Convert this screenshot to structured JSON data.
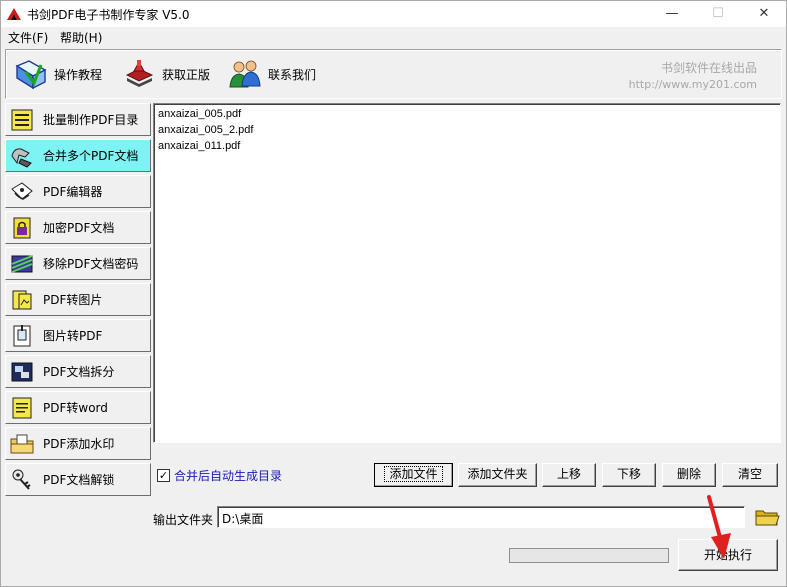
{
  "window": {
    "title": "书剑PDF电子书制作专家 V5.0",
    "minimize": "—",
    "maximize": "☐",
    "close": "✕"
  },
  "menu": [
    {
      "label": "文件(F)"
    },
    {
      "label": "帮助(H)"
    }
  ],
  "toolbar": {
    "tutorial": "操作教程",
    "buy": "获取正版",
    "contact": "联系我们",
    "brand_line1": "书剑软件在线出品",
    "brand_line2": "http://www.my201.com"
  },
  "sidebar": {
    "items": [
      {
        "label": "批量制作PDF目录",
        "icon": "toc-list-icon"
      },
      {
        "label": "合并多个PDF文档",
        "icon": "merge-tool-icon",
        "active": true
      },
      {
        "label": "PDF编辑器",
        "icon": "editor-hand-icon"
      },
      {
        "label": "加密PDF文档",
        "icon": "encrypt-lock-icon"
      },
      {
        "label": "移除PDF文档密码",
        "icon": "remove-password-icon"
      },
      {
        "label": "PDF转图片",
        "icon": "pdf-to-image-icon"
      },
      {
        "label": "图片转PDF",
        "icon": "image-to-pdf-icon"
      },
      {
        "label": "PDF文档拆分",
        "icon": "split-document-icon"
      },
      {
        "label": "PDF转word",
        "icon": "pdf-to-word-icon"
      },
      {
        "label": "PDF添加水印",
        "icon": "watermark-folder-icon"
      },
      {
        "label": "PDF文档解锁",
        "icon": "unlock-keys-icon"
      }
    ]
  },
  "files": [
    "anxaizai_005.pdf",
    "anxaizai_005_2.pdf",
    "anxaizai_011.pdf"
  ],
  "options": {
    "auto_toc_label": "合并后自动生成目录",
    "auto_toc_checked": true,
    "check_mark": "✓"
  },
  "buttons": {
    "add_file": "添加文件",
    "add_folder": "添加文件夹",
    "move_up": "上移",
    "move_down": "下移",
    "delete": "删除",
    "clear": "清空",
    "start": "开始执行"
  },
  "output": {
    "label": "输出文件夹",
    "path": "D:\\桌面"
  },
  "progress": {
    "value": 0
  },
  "colors": {
    "active_item": "#7df3f3",
    "checkbox_label": "#1a1ab8",
    "brand_text": "#a8a8a8",
    "annotation_arrow": "#e02020"
  }
}
